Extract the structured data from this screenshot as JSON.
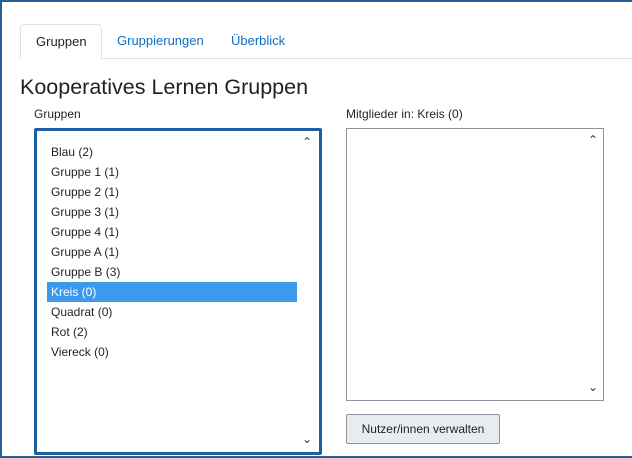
{
  "tabs": [
    {
      "label": "Gruppen",
      "active": true
    },
    {
      "label": "Gruppierungen",
      "active": false
    },
    {
      "label": "Überblick",
      "active": false
    }
  ],
  "page_title": "Kooperatives Lernen  Gruppen",
  "groups": {
    "label": "Gruppen",
    "items": [
      "Blau (2)",
      "Gruppe 1 (1)",
      "Gruppe 2 (1)",
      "Gruppe 3 (1)",
      "Gruppe 4 (1)",
      "Gruppe A (1)",
      "Gruppe B (3)",
      "Kreis (0)",
      "Quadrat (0)",
      "Rot (2)",
      "Viereck (0)"
    ],
    "selected_index": 7
  },
  "members": {
    "label": "Mitglieder in: Kreis (0)",
    "items": []
  },
  "buttons": {
    "manage_users": "Nutzer/innen verwalten"
  },
  "colors": {
    "frame_border": "#2a5d94",
    "list_focus_border": "#1f5fa0",
    "selection": "#3c99ee",
    "link": "#0f6cbf"
  },
  "icons": {
    "scroll_up": "chevron-up-icon",
    "scroll_down": "chevron-down-icon"
  }
}
